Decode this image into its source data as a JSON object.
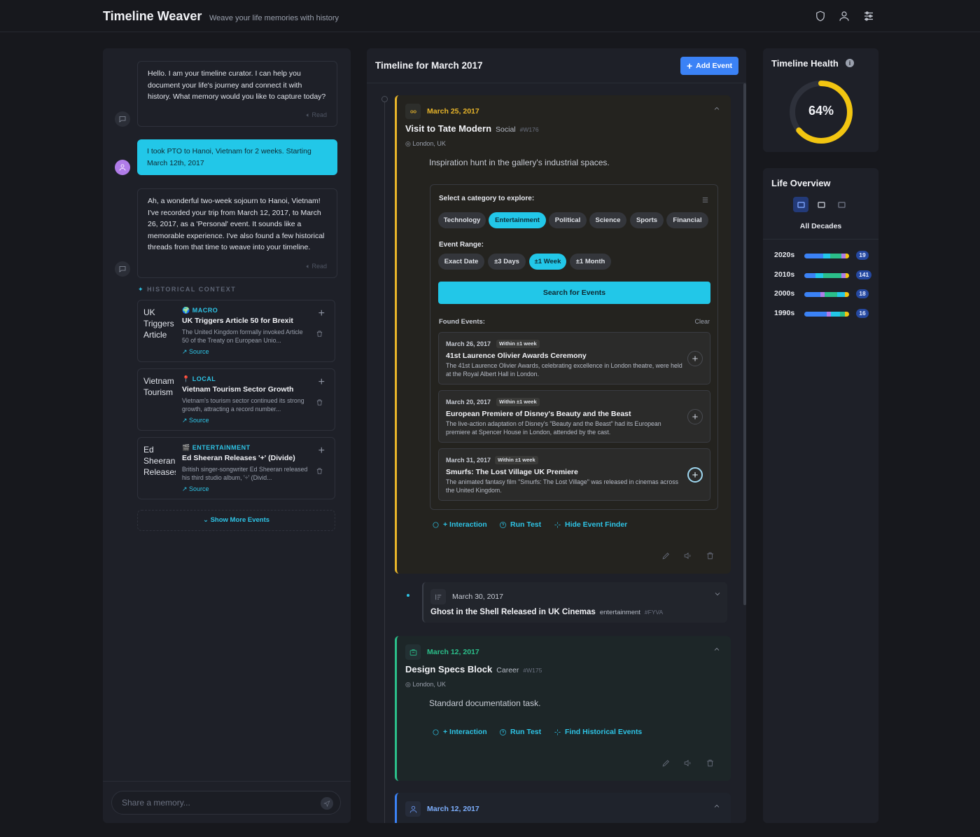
{
  "header": {
    "title": "Timeline Weaver",
    "subtitle": "Weave your life memories with history",
    "icons": [
      "shield-icon",
      "user-icon",
      "sliders-icon"
    ]
  },
  "chat": {
    "messages": [
      {
        "role": "bot",
        "text": "Hello. I am your timeline curator. I can help you document your life's journey and connect it with history. What memory would you like to capture today?",
        "read_label": "Read"
      },
      {
        "role": "user",
        "text": "I took PTO to Hanoi, Vietnam for 2 weeks. Starting March 12th, 2017"
      },
      {
        "role": "bot",
        "text": "Ah, a wonderful two-week sojourn to Hanoi, Vietnam! I've recorded your trip from March 12, 2017, to March 26, 2017, as a 'Personal' event. It sounds like a memorable experience. I've also found a few historical threads from that time to weave into your timeline.",
        "read_label": "Read"
      }
    ],
    "historical_context_label": "HISTORICAL CONTEXT",
    "historical": [
      {
        "thumb_alt": "UK Triggers Article",
        "category": "MACRO",
        "icon": "🌍",
        "title": "UK Triggers Article 50 for Brexit",
        "desc": "The United Kingdom formally invoked Article 50 of the Treaty on European Unio...",
        "source": "Source"
      },
      {
        "thumb_alt": "Vietnam Tourism",
        "category": "LOCAL",
        "icon": "📍",
        "title": "Vietnam Tourism Sector Growth",
        "desc": "Vietnam's tourism sector continued its strong growth, attracting a record number...",
        "source": "Source"
      },
      {
        "thumb_alt": "Ed Sheeran Releases",
        "category": "ENTERTAINMENT",
        "icon": "🎬",
        "title": "Ed Sheeran Releases '+' (Divide)",
        "desc": "British singer-songwriter Ed Sheeran released his third studio album, '÷' (Divid...",
        "source": "Source"
      }
    ],
    "show_more": "Show More Events",
    "input_placeholder": "Share a memory..."
  },
  "timeline": {
    "title": "Timeline for March 2017",
    "add_event": "Add Event",
    "events": [
      {
        "date": "March 25, 2017",
        "title": "Visit to Tate Modern",
        "category": "Social",
        "code": "#W176",
        "location": "London, UK",
        "desc": "Inspiration hunt in the gallery's industrial spaces.",
        "accent": "#e8b52a"
      },
      {
        "date": "March 30, 2017",
        "title": "Ghost in the Shell Released in UK Cinemas",
        "category": "entertainment",
        "code": "#FYVA"
      },
      {
        "date": "March 12, 2017",
        "title": "Design Specs Block",
        "category": "Career",
        "code": "#W175",
        "location": "London, UK",
        "desc": "Standard documentation task.",
        "accent": "#2bbf8a"
      },
      {
        "date": "March 12, 2017",
        "accent": "#3b82f6"
      }
    ],
    "finder": {
      "category_label": "Select a category to explore:",
      "categories": [
        "Technology",
        "Entertainment",
        "Political",
        "Science",
        "Sports",
        "Financial"
      ],
      "active_category": "Entertainment",
      "range_label": "Event Range:",
      "ranges": [
        "Exact Date",
        "±3 Days",
        "±1 Week",
        "±1 Month"
      ],
      "active_range": "±1 Week",
      "search_label": "Search for Events",
      "found_label": "Found Events:",
      "clear_label": "Clear",
      "found": [
        {
          "date": "March 26, 2017",
          "badge": "Within ±1 week",
          "title": "41st Laurence Olivier Awards Ceremony",
          "desc": "The 41st Laurence Olivier Awards, celebrating excellence in London theatre, were held at the Royal Albert Hall in London."
        },
        {
          "date": "March 20, 2017",
          "badge": "Within ±1 week",
          "title": "European Premiere of Disney's Beauty and the Beast",
          "desc": "The live-action adaptation of Disney's \"Beauty and the Beast\" had its European premiere at Spencer House in London, attended by the cast."
        },
        {
          "date": "March 31, 2017",
          "badge": "Within ±1 week",
          "title": "Smurfs: The Lost Village UK Premiere",
          "desc": "The animated fantasy film \"Smurfs: The Lost Village\" was released in cinemas across the United Kingdom."
        }
      ]
    },
    "actions": {
      "interaction": "+ Interaction",
      "run_test": "Run Test",
      "hide_finder": "Hide Event Finder",
      "find_historical": "Find Historical Events"
    }
  },
  "health": {
    "title": "Timeline Health",
    "percent_label": "64%",
    "percent": 64,
    "color": "#f2c511"
  },
  "life": {
    "title": "Life Overview",
    "scope_label": "All Decades",
    "decades": [
      {
        "label": "2020s",
        "count": "19"
      },
      {
        "label": "2010s",
        "count": "141"
      },
      {
        "label": "2000s",
        "count": "18"
      },
      {
        "label": "1990s",
        "count": "16"
      }
    ]
  }
}
